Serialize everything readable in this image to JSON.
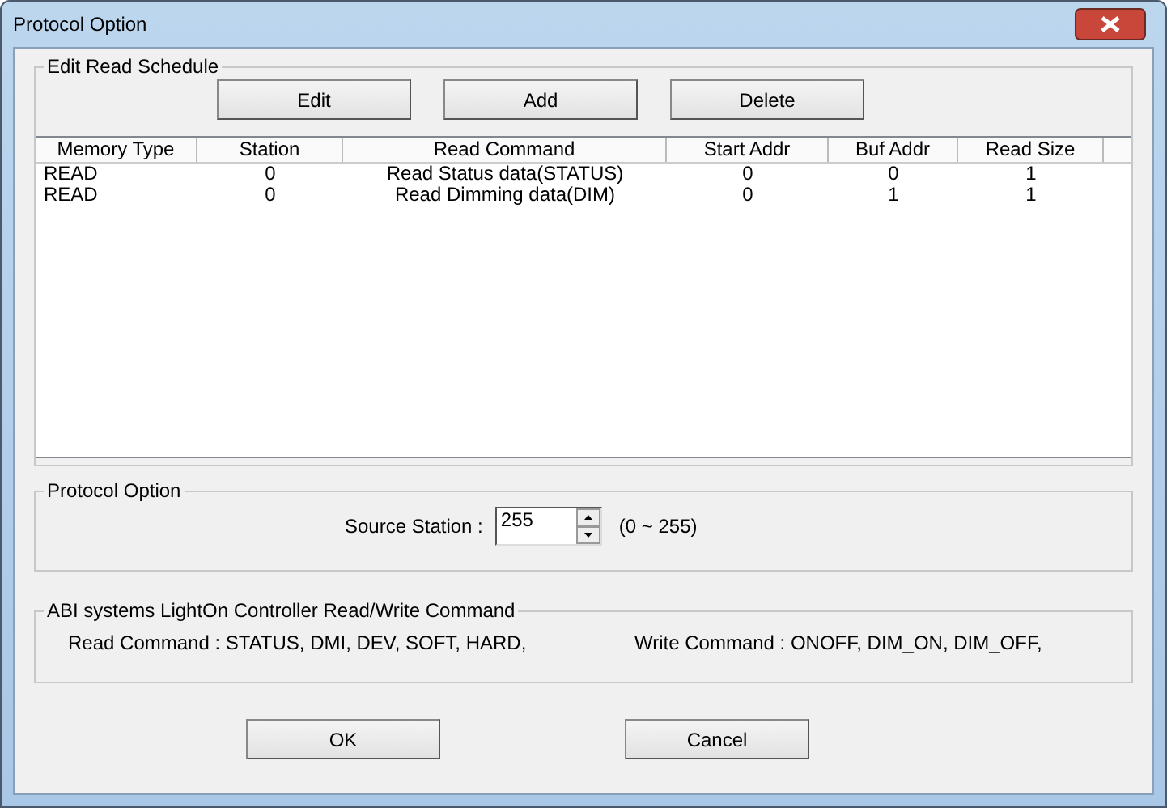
{
  "window": {
    "title": "Protocol Option"
  },
  "schedule": {
    "title": "Edit Read Schedule",
    "buttons": [
      "Edit",
      "Add",
      "Delete"
    ],
    "columns": [
      "Memory Type",
      "Station",
      "Read Command",
      "Start Addr",
      "Buf Addr",
      "Read Size"
    ],
    "rows": [
      [
        "READ",
        "0",
        "Read Status data(STATUS)",
        "0",
        "0",
        "1"
      ],
      [
        "READ",
        "0",
        "Read Dimming data(DIM)",
        "0",
        "1",
        "1"
      ]
    ]
  },
  "protocol": {
    "title": "Protocol Option",
    "label": "Source Station :",
    "value": "255",
    "range": "(0 ~ 255)"
  },
  "commands": {
    "title": "ABI systems LightOn Controller Read/Write Command",
    "read": "Read Command : STATUS, DMI, DEV, SOFT, HARD,",
    "write": "Write Command : ONOFF, DIM_ON, DIM_OFF,"
  },
  "buttons": [
    "OK",
    "Cancel"
  ]
}
